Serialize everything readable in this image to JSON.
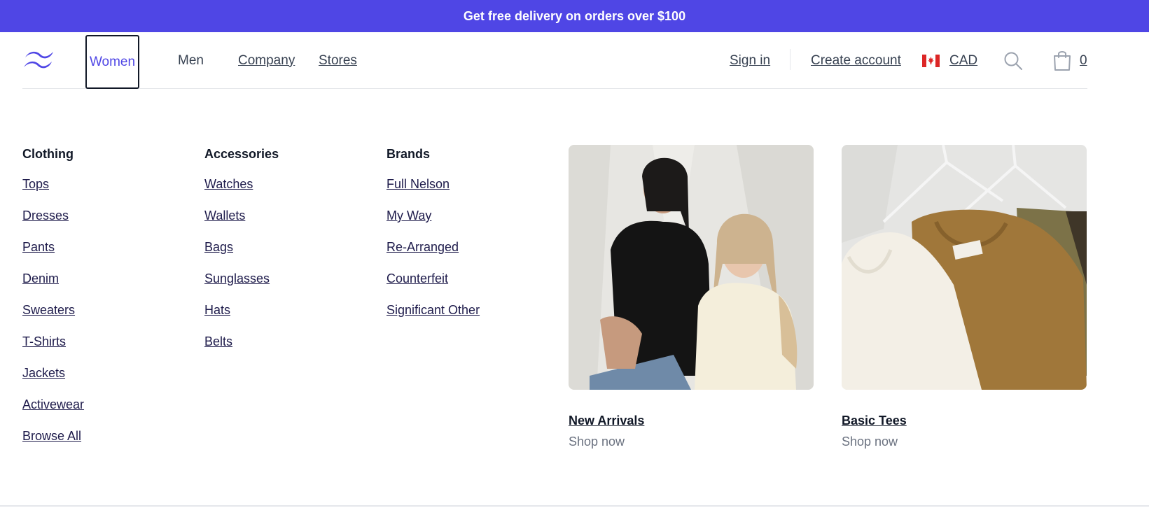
{
  "banner": {
    "text": "Get free delivery on orders over $100"
  },
  "brand": {
    "accent": "#4f46e5",
    "logo_icon": "tailwind-wave-logo"
  },
  "nav": {
    "women": "Women",
    "men": "Men",
    "company": "Company",
    "stores": "Stores"
  },
  "account": {
    "sign_in": "Sign in",
    "create_account": "Create account",
    "currency": "CAD",
    "currency_flag_icon": "canada-flag-icon",
    "search_icon": "search-icon",
    "cart_icon": "shopping-bag-icon",
    "cart_count": "0"
  },
  "menu": {
    "columns": [
      {
        "heading": "Clothing",
        "items": [
          "Tops",
          "Dresses",
          "Pants",
          "Denim",
          "Sweaters",
          "T-Shirts",
          "Jackets",
          "Activewear",
          "Browse All"
        ]
      },
      {
        "heading": "Accessories",
        "items": [
          "Watches",
          "Wallets",
          "Bags",
          "Sunglasses",
          "Hats",
          "Belts"
        ]
      },
      {
        "heading": "Brands",
        "items": [
          "Full Nelson",
          "My Way",
          "Re-Arranged",
          "Counterfeit",
          "Significant Other"
        ]
      }
    ],
    "promos": [
      {
        "title": "New Arrivals",
        "cta": "Shop now"
      },
      {
        "title": "Basic Tees",
        "cta": "Shop now"
      }
    ]
  }
}
